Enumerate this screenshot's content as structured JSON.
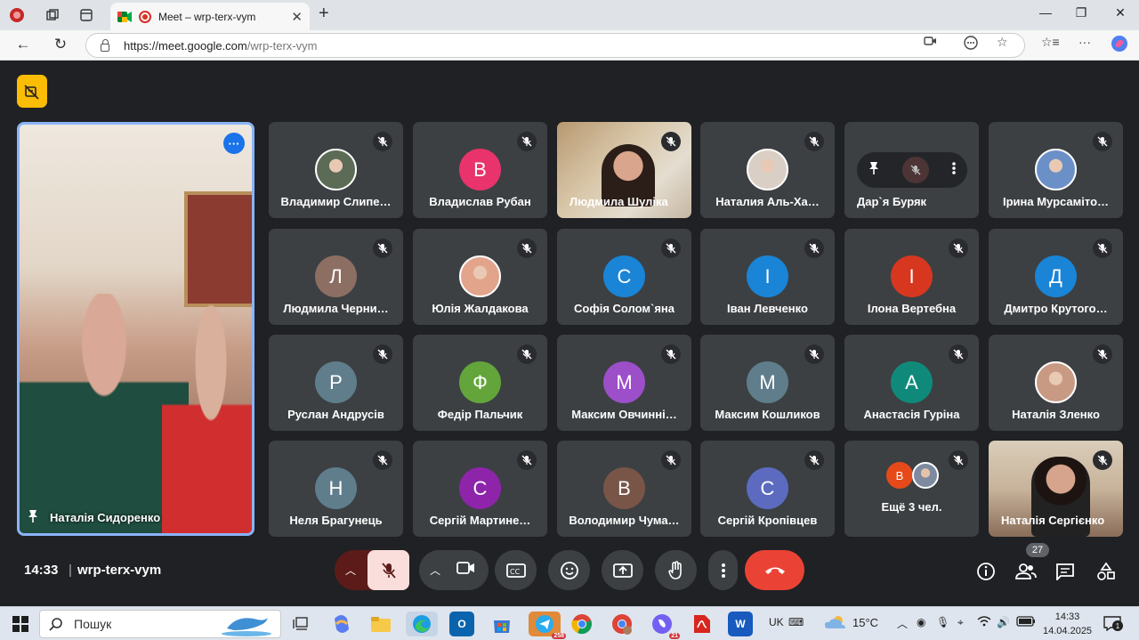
{
  "browser": {
    "tab_title": "Meet – wrp-terx-vym",
    "url_host": "https://meet.google.com",
    "url_path": "/wrp-terx-vym"
  },
  "meeting": {
    "pinned_name": "Наталія Сидоренко",
    "time": "14:33",
    "separator": "|",
    "code": "wrp-terx-vym",
    "participants_count": "27"
  },
  "tiles": [
    {
      "name": "Владимир Слипе…",
      "type": "photo",
      "color": "#5b6b55"
    },
    {
      "name": "Владислав Рубан",
      "type": "letter",
      "letter": "В",
      "color": "#e8336c"
    },
    {
      "name": "Людмила Шуліка",
      "type": "video"
    },
    {
      "name": "Наталия Аль-Ха…",
      "type": "photo",
      "color": "#d9cfc4"
    },
    {
      "name": "Дар`я Буряк",
      "type": "hover"
    },
    {
      "name": "Ірина Мурсаміто…",
      "type": "photo",
      "color": "#6b8fc7"
    },
    {
      "name": "Людмила Черни…",
      "type": "letter",
      "letter": "Л",
      "color": "#8d6e63"
    },
    {
      "name": "Юлія Жалдакова",
      "type": "photo",
      "color": "#e3a48c"
    },
    {
      "name": "Софія Солом`яна",
      "type": "letter",
      "letter": "С",
      "color": "#1a84d6"
    },
    {
      "name": "Іван Левченко",
      "type": "letter",
      "letter": "І",
      "color": "#1a84d6"
    },
    {
      "name": "Ілона Вертебна",
      "type": "letter",
      "letter": "І",
      "color": "#d7371f"
    },
    {
      "name": "Дмитро Крутого…",
      "type": "letter",
      "letter": "Д",
      "color": "#1a84d6"
    },
    {
      "name": "Руслан Андрусів",
      "type": "letter",
      "letter": "Р",
      "color": "#607d8b"
    },
    {
      "name": "Федір Пальчик",
      "type": "letter",
      "letter": "Ф",
      "color": "#63a53b"
    },
    {
      "name": "Максим Овчинні…",
      "type": "letter",
      "letter": "М",
      "color": "#9c4fc9"
    },
    {
      "name": "Максим Кошликов",
      "type": "letter",
      "letter": "М",
      "color": "#607d8b"
    },
    {
      "name": "Анастасія Гуріна",
      "type": "letter",
      "letter": "А",
      "color": "#0f8a7a"
    },
    {
      "name": "Наталія Зленко",
      "type": "photo",
      "color": "#c89a84"
    },
    {
      "name": "Неля Брагунець",
      "type": "letter",
      "letter": "Н",
      "color": "#607d8b"
    },
    {
      "name": "Сергій Мартине…",
      "type": "letter",
      "letter": "С",
      "color": "#8e24aa"
    },
    {
      "name": "Володимир Чума…",
      "type": "letter",
      "letter": "В",
      "color": "#795548"
    },
    {
      "name": "Сергій Кропівцев",
      "type": "letter",
      "letter": "С",
      "color": "#5c6bc0"
    },
    {
      "name": "Ещё 3 чел.",
      "type": "more",
      "mini_letter": "В",
      "mini_color": "#e64a19"
    },
    {
      "name": "Наталія Сергієнко",
      "type": "video2"
    }
  ],
  "taskbar": {
    "search_label": "Пошук",
    "badge_telegram": "258",
    "badge_viber": "21",
    "lang": "UK",
    "temp": "15°C",
    "clock_time": "14:33",
    "clock_date": "14.04.2025",
    "notif_count": "1"
  }
}
